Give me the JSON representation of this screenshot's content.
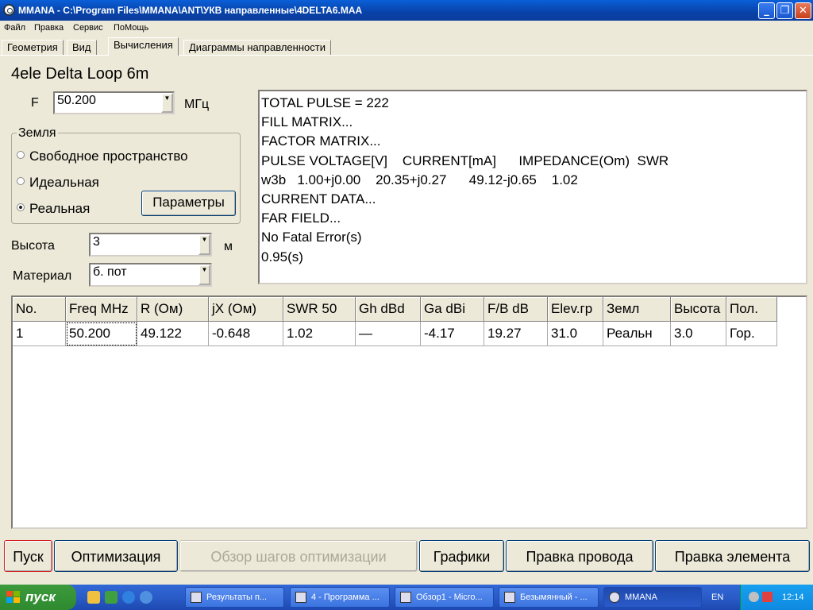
{
  "window": {
    "title": "MMANA - C:\\Program Files\\MMANA\\ANT\\УКВ направленные\\4DELTA6.MAA"
  },
  "menu": [
    "Файл",
    "Правка",
    "Сервис",
    "ПоМощь"
  ],
  "tabs": [
    {
      "label": "Геометрия",
      "active": false
    },
    {
      "label": "Вид",
      "active": false
    },
    {
      "label": "Вычисления",
      "active": true
    },
    {
      "label": "Диаграммы направленности",
      "active": false
    }
  ],
  "project_title": "4ele Delta Loop 6m",
  "frequency": {
    "label": "F",
    "value": "50.200",
    "unit": "МГц"
  },
  "ground": {
    "legend": "Земля",
    "options": [
      {
        "label": "Свободное пространство",
        "selected": false
      },
      {
        "label": "Идеальная",
        "selected": false
      },
      {
        "label": "Реальная",
        "selected": true
      }
    ],
    "params_button": "Параметры"
  },
  "height": {
    "label": "Высота",
    "value": "3",
    "unit": "м"
  },
  "material": {
    "label": "Материал",
    "value": "б. пот"
  },
  "log_lines": [
    "TOTAL PULSE = 222",
    "FILL MATRIX...",
    "FACTOR MATRIX...",
    "PULSE VOLTAGE[V]    CURRENT[mA]      IMPEDANCE(Om)  SWR",
    "w3b   1.00+j0.00    20.35+j0.27      49.12-j0.65    1.02",
    "CURRENT DATA...",
    "FAR FIELD...",
    "No Fatal Error(s)",
    "0.95(s)"
  ],
  "results_table": {
    "columns": [
      "No.",
      "Freq MHz",
      "R (Ом)",
      "jX (Ом)",
      "SWR 50",
      "Gh dBd",
      "Ga dBi",
      "F/B dB",
      "Elev.гр",
      "Земл",
      "Высота",
      "Пол."
    ],
    "rows": [
      [
        "1",
        "50.200",
        "49.122",
        "-0.648",
        "1.02",
        "—",
        "-4.17",
        "19.27",
        "31.0",
        "Реальн",
        "3.0",
        "Гор."
      ]
    ]
  },
  "buttons": {
    "start": "Пуск",
    "optimize": "Оптимизация",
    "review_steps": "Обзор шагов оптимизации",
    "graphs": "Графики",
    "edit_wire": "Правка провода",
    "edit_element": "Правка элемента"
  },
  "taskbar": {
    "start": "пуск",
    "tasks": [
      "Результаты п...",
      "4 - Программа ...",
      "Обзор1 - Micro...",
      "Безымянный - ...",
      "MMANA"
    ],
    "language": "EN",
    "clock": "12:14"
  },
  "colors": {
    "titlebar": "#0842a8",
    "taskbar": "#2a5cc8",
    "start_green": "#3c9a3c",
    "focus_red": "#d02020"
  }
}
